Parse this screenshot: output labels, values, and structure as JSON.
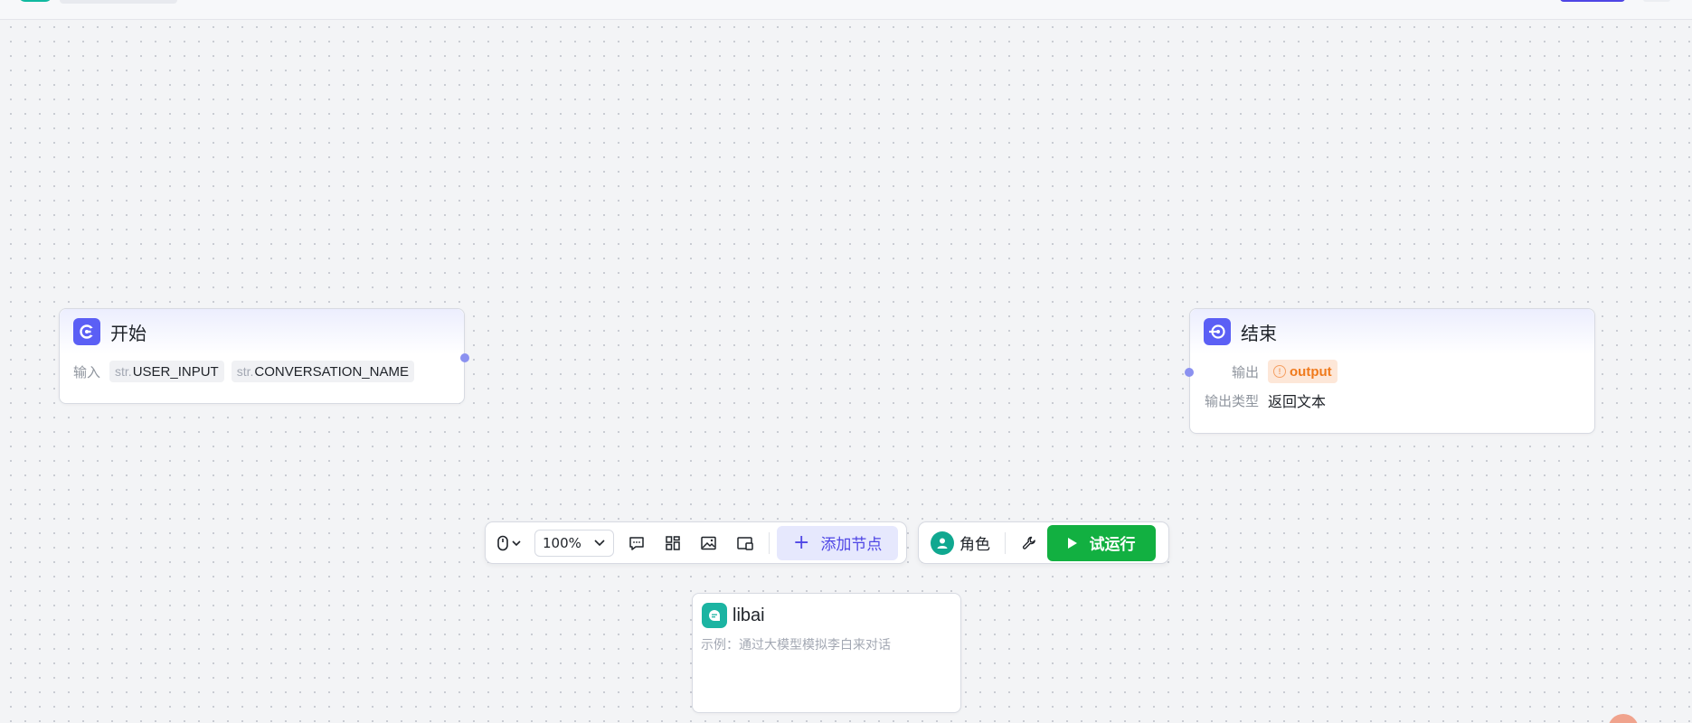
{
  "canvas": {
    "start_node": {
      "title": "开始",
      "input_label": "输入",
      "params": [
        {
          "type": "str.",
          "name": "USER_INPUT"
        },
        {
          "type": "str.",
          "name": "CONVERSATION_NAME"
        }
      ]
    },
    "end_node": {
      "title": "结束",
      "output_label": "输出",
      "output_var": "output",
      "output_type_label": "输出类型",
      "output_type_value": "返回文本"
    },
    "libai_node": {
      "title": "libai",
      "description": "示例：通过大模型模拟李白来对话"
    }
  },
  "toolbar": {
    "zoom_value": "100%",
    "add_node_label": "添加节点",
    "role_label": "角色",
    "run_label": "试运行"
  },
  "colors": {
    "accent": "#4f46e5",
    "node_icon": "#5b5ff5",
    "run_green": "#12b041",
    "warning": "#f07a1c",
    "teal": "#1bb4a2"
  },
  "icons": {
    "start": "start-node-icon",
    "end": "end-node-icon",
    "libai": "chat-node-icon",
    "mouse": "mouse-icon",
    "comment": "comment-icon",
    "layout": "layout-icon",
    "image": "image-icon",
    "minimap": "minimap-icon",
    "role": "user-avatar-icon",
    "tool": "wrench-icon",
    "run": "play-icon"
  }
}
